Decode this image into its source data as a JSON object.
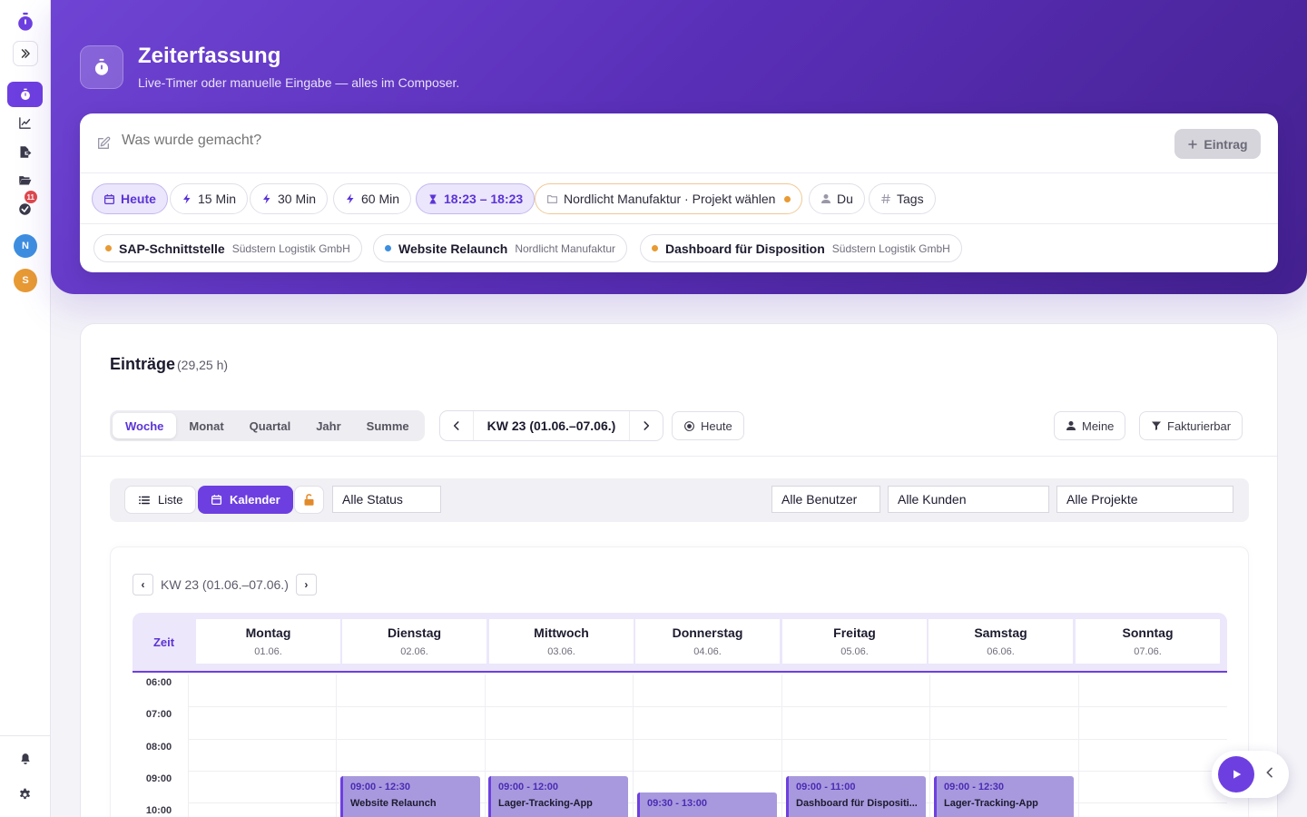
{
  "sidebar": {
    "notifications_badge": "11",
    "avatars": [
      {
        "initial": "N",
        "color": "#3d8ee0"
      },
      {
        "initial": "S",
        "color": "#e89a33"
      }
    ]
  },
  "header": {
    "title": "Zeiterfassung",
    "subtitle": "Live-Timer oder manuelle Eingabe — alles im Composer."
  },
  "composer": {
    "placeholder": "Was wurde gemacht?",
    "add_label": "Eintrag",
    "chips": {
      "today": "Heute",
      "min15": "15 Min",
      "min30": "30 Min",
      "min60": "60 Min",
      "time_range": "18:23 – 18:23",
      "project": "Nordlicht Manufaktur · Projekt wählen",
      "user": "Du",
      "tags": "Tags"
    },
    "recent_projects": [
      {
        "name": "SAP-Schnittstelle",
        "client": "Südstern Logistik GmbH",
        "color": "#e89a33"
      },
      {
        "name": "Website Relaunch",
        "client": "Nordlicht Manufaktur",
        "color": "#3d8ee0"
      },
      {
        "name": "Dashboard für Disposition",
        "client": "Südstern Logistik GmbH",
        "color": "#e89a33"
      }
    ]
  },
  "entries": {
    "title": "Einträge",
    "total": "(29,25 h)",
    "periods": [
      "Woche",
      "Monat",
      "Quartal",
      "Jahr",
      "Summe"
    ],
    "active_period": "Woche",
    "week_label": "KW 23 (01.06.–07.06.)",
    "today_label": "Heute",
    "mine_label": "Meine",
    "billable_label": "Fakturierbar",
    "view_list": "Liste",
    "view_calendar": "Kalender",
    "filter_status": "Alle Status",
    "filter_users": "Alle Benutzer",
    "filter_clients": "Alle Kunden",
    "filter_projects": "Alle Projekte"
  },
  "calendar": {
    "week_label": "KW 23 (01.06.–07.06.)",
    "time_header": "Zeit",
    "days": [
      {
        "name": "Montag",
        "date": "01.06."
      },
      {
        "name": "Dienstag",
        "date": "02.06."
      },
      {
        "name": "Mittwoch",
        "date": "03.06."
      },
      {
        "name": "Donnerstag",
        "date": "04.06."
      },
      {
        "name": "Freitag",
        "date": "05.06."
      },
      {
        "name": "Samstag",
        "date": "06.06."
      },
      {
        "name": "Sonntag",
        "date": "07.06."
      }
    ],
    "hours": [
      "06:00",
      "07:00",
      "08:00",
      "09:00",
      "10:00"
    ],
    "events": [
      {
        "day": 1,
        "time": "09:00 - 12:30",
        "title": "Website Relaunch"
      },
      {
        "day": 2,
        "time": "09:00 - 12:00",
        "title": "Lager-Tracking-App"
      },
      {
        "day": 3,
        "time": "09:30 - 13:00",
        "title": ""
      },
      {
        "day": 4,
        "time": "09:00 - 11:00",
        "title": "Dashboard für Dispositi..."
      },
      {
        "day": 5,
        "time": "09:00 - 12:30",
        "title": "Lager-Tracking-App"
      }
    ]
  }
}
